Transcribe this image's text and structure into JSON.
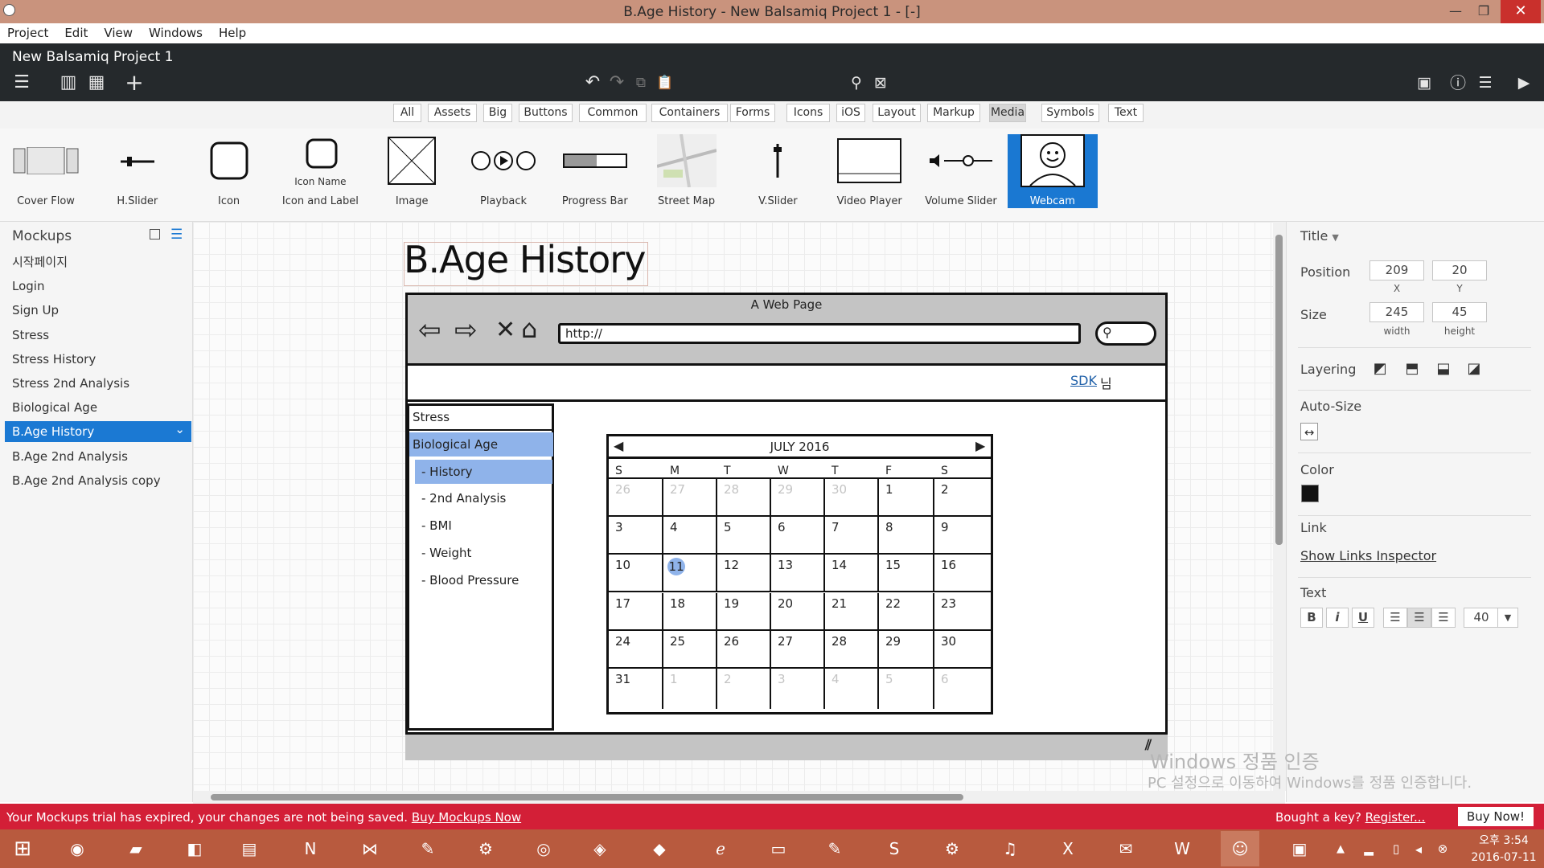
{
  "window": {
    "title": "B.Age History - New Balsamiq Project 1 - [-]",
    "minimize": "—",
    "maximize": "❐",
    "close": "✕"
  },
  "menu": [
    "Project",
    "Edit",
    "View",
    "Windows",
    "Help"
  ],
  "project": {
    "name": "New Balsamiq Project 1"
  },
  "filters": [
    "All",
    "Assets",
    "Big",
    "Buttons",
    "Common",
    "Containers",
    "Forms",
    "Icons",
    "iOS",
    "Layout",
    "Markup",
    "Media",
    "Symbols",
    "Text"
  ],
  "filter_selected": "Media",
  "library": [
    {
      "label": "Cover Flow",
      "icon": "cover-flow"
    },
    {
      "label": "H.Slider",
      "icon": "h-slider"
    },
    {
      "label": "Icon",
      "icon": "icon"
    },
    {
      "label": "Icon and Label",
      "icon": "icon-and-label",
      "sub": "Icon Name"
    },
    {
      "label": "Image",
      "icon": "image"
    },
    {
      "label": "Playback",
      "icon": "playback"
    },
    {
      "label": "Progress Bar",
      "icon": "progress-bar"
    },
    {
      "label": "Street Map",
      "icon": "street-map"
    },
    {
      "label": "V.Slider",
      "icon": "v-slider"
    },
    {
      "label": "Video Player",
      "icon": "video-player"
    },
    {
      "label": "Volume Slider",
      "icon": "volume-slider"
    },
    {
      "label": "Webcam",
      "icon": "webcam"
    }
  ],
  "library_selected": "Webcam",
  "mockups": {
    "title": "Mockups",
    "items": [
      "시작페이지",
      "Login",
      "Sign Up",
      "Stress",
      "Stress History",
      "Stress 2nd Analysis",
      "Biological Age",
      "B.Age History",
      "B.Age 2nd Analysis",
      "B.Age 2nd Analysis copy"
    ],
    "selected": "B.Age History"
  },
  "mockup": {
    "title": "B.Age History",
    "page_title": "A Web Page",
    "url": "http://",
    "sdk": "SDK",
    "nim": "님",
    "side_menu": [
      {
        "label": "Stress",
        "level": 0,
        "state": "normal"
      },
      {
        "label": "Biological Age",
        "level": 0,
        "state": "selected"
      },
      {
        "label": "- History",
        "level": 1,
        "state": "selected"
      },
      {
        "label": "- 2nd Analysis",
        "level": 1,
        "state": "normal"
      },
      {
        "label": "- BMI",
        "level": 1,
        "state": "normal"
      },
      {
        "label": "- Weight",
        "level": 1,
        "state": "normal"
      },
      {
        "label": "- Blood Pressure",
        "level": 1,
        "state": "normal"
      }
    ],
    "calendar": {
      "month": "JULY 2016",
      "days_of_week": [
        "S",
        "M",
        "T",
        "W",
        "T",
        "F",
        "S"
      ],
      "weeks": [
        [
          "26",
          "27",
          "28",
          "29",
          "30",
          "1",
          "2"
        ],
        [
          "3",
          "4",
          "5",
          "6",
          "7",
          "8",
          "9"
        ],
        [
          "10",
          "11",
          "12",
          "13",
          "14",
          "15",
          "16"
        ],
        [
          "17",
          "18",
          "19",
          "20",
          "21",
          "22",
          "23"
        ],
        [
          "24",
          "25",
          "26",
          "27",
          "28",
          "29",
          "30"
        ],
        [
          "31",
          "1",
          "2",
          "3",
          "4",
          "5",
          "6"
        ]
      ],
      "dim_first_row": 5,
      "dim_last_row_from": 1,
      "selected": "11"
    }
  },
  "inspector": {
    "section": "Title",
    "position_label": "Position",
    "x": "209",
    "x_cap": "X",
    "y": "20",
    "y_cap": "Y",
    "size_label": "Size",
    "width": "245",
    "width_cap": "width",
    "height": "45",
    "height_cap": "height",
    "layering_label": "Layering",
    "autosize_label": "Auto-Size",
    "color_label": "Color",
    "color_value": "#111111",
    "link_label": "Link",
    "link_action": "Show Links Inspector",
    "text_label": "Text",
    "bold": "B",
    "italic": "i",
    "underline": "U",
    "font_size": "40"
  },
  "trial": {
    "message": "Your Mockups trial has expired, your changes are not being saved.",
    "buy_link": "Buy Mockups Now",
    "key_question": "Bought a key?",
    "register": "Register...",
    "buy_now": "Buy Now!"
  },
  "watermark": {
    "line1": "Windows 정품 인증",
    "line2": "PC 설정으로 이동하여 Windows를 정품 인증합니다."
  },
  "clock": {
    "time": "오후 3:54",
    "date": "2016-07-11"
  },
  "colors": {
    "accent": "#1b79d3",
    "titlebar": "#c9937d",
    "trial": "#d31f37",
    "taskbar": "#b85a3e",
    "selected_menu": "#8fb3ea"
  }
}
